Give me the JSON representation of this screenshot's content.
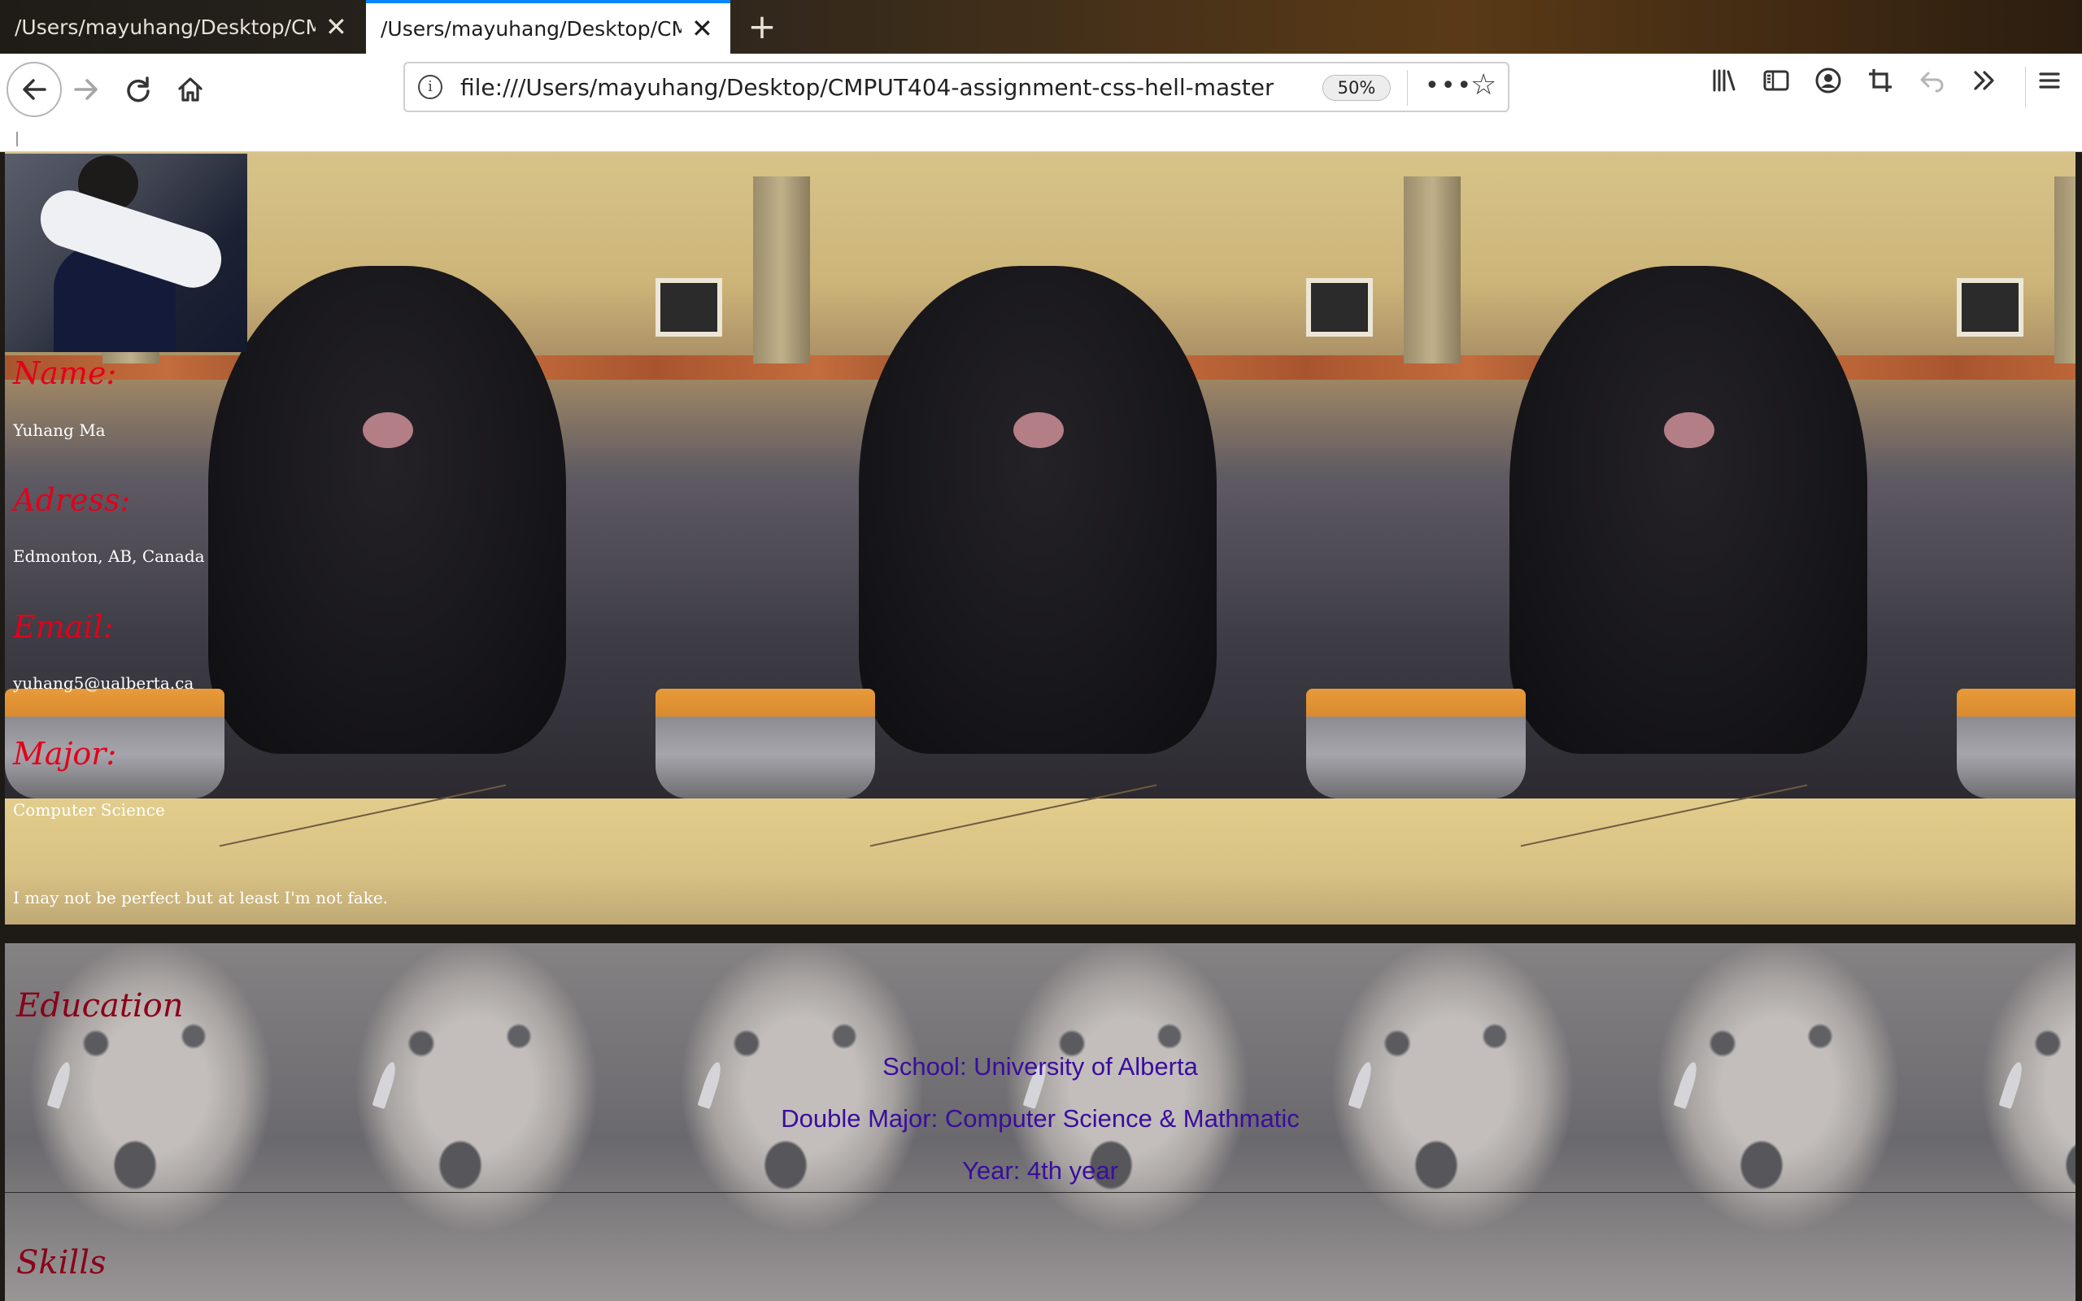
{
  "tabs": [
    {
      "title": "/Users/mayuhang/Desktop/CMPUT4",
      "close_icon": "close-icon",
      "active": false
    },
    {
      "title": "/Users/mayuhang/Desktop/CMPUT4",
      "close_icon": "close-icon",
      "active": true
    }
  ],
  "toolbar": {
    "url": "file:///Users/mayuhang/Desktop/CMPUT404-assignment-css-hell-master/hom",
    "zoom": "50%",
    "more_icon": "•••",
    "icons": [
      "back-arrow-icon",
      "forward-arrow-icon",
      "reload-icon",
      "home-icon",
      "info-icon",
      "star-icon",
      "library-icon",
      "sidebar-icon",
      "account-icon",
      "crop-icon",
      "undo-icon",
      "overflow-icon",
      "menu-icon"
    ]
  },
  "profile": {
    "name_label": "Name:",
    "name_value": "Yuhang Ma",
    "address_label": "Adress:",
    "address_value": "Edmonton, AB, Canada",
    "email_label": "Email:",
    "email_value": "yuhang5@ualberta.ca",
    "major_label": "Major:",
    "major_value": "Computer Science",
    "tagline": "I may not be perfect but at least I'm not fake."
  },
  "education": {
    "heading": "Education",
    "school": "School: University of Alberta",
    "major": "Double Major: Computer Science & Mathmatic",
    "year": "Year: 4th year"
  },
  "skills": {
    "heading": "Skills"
  }
}
